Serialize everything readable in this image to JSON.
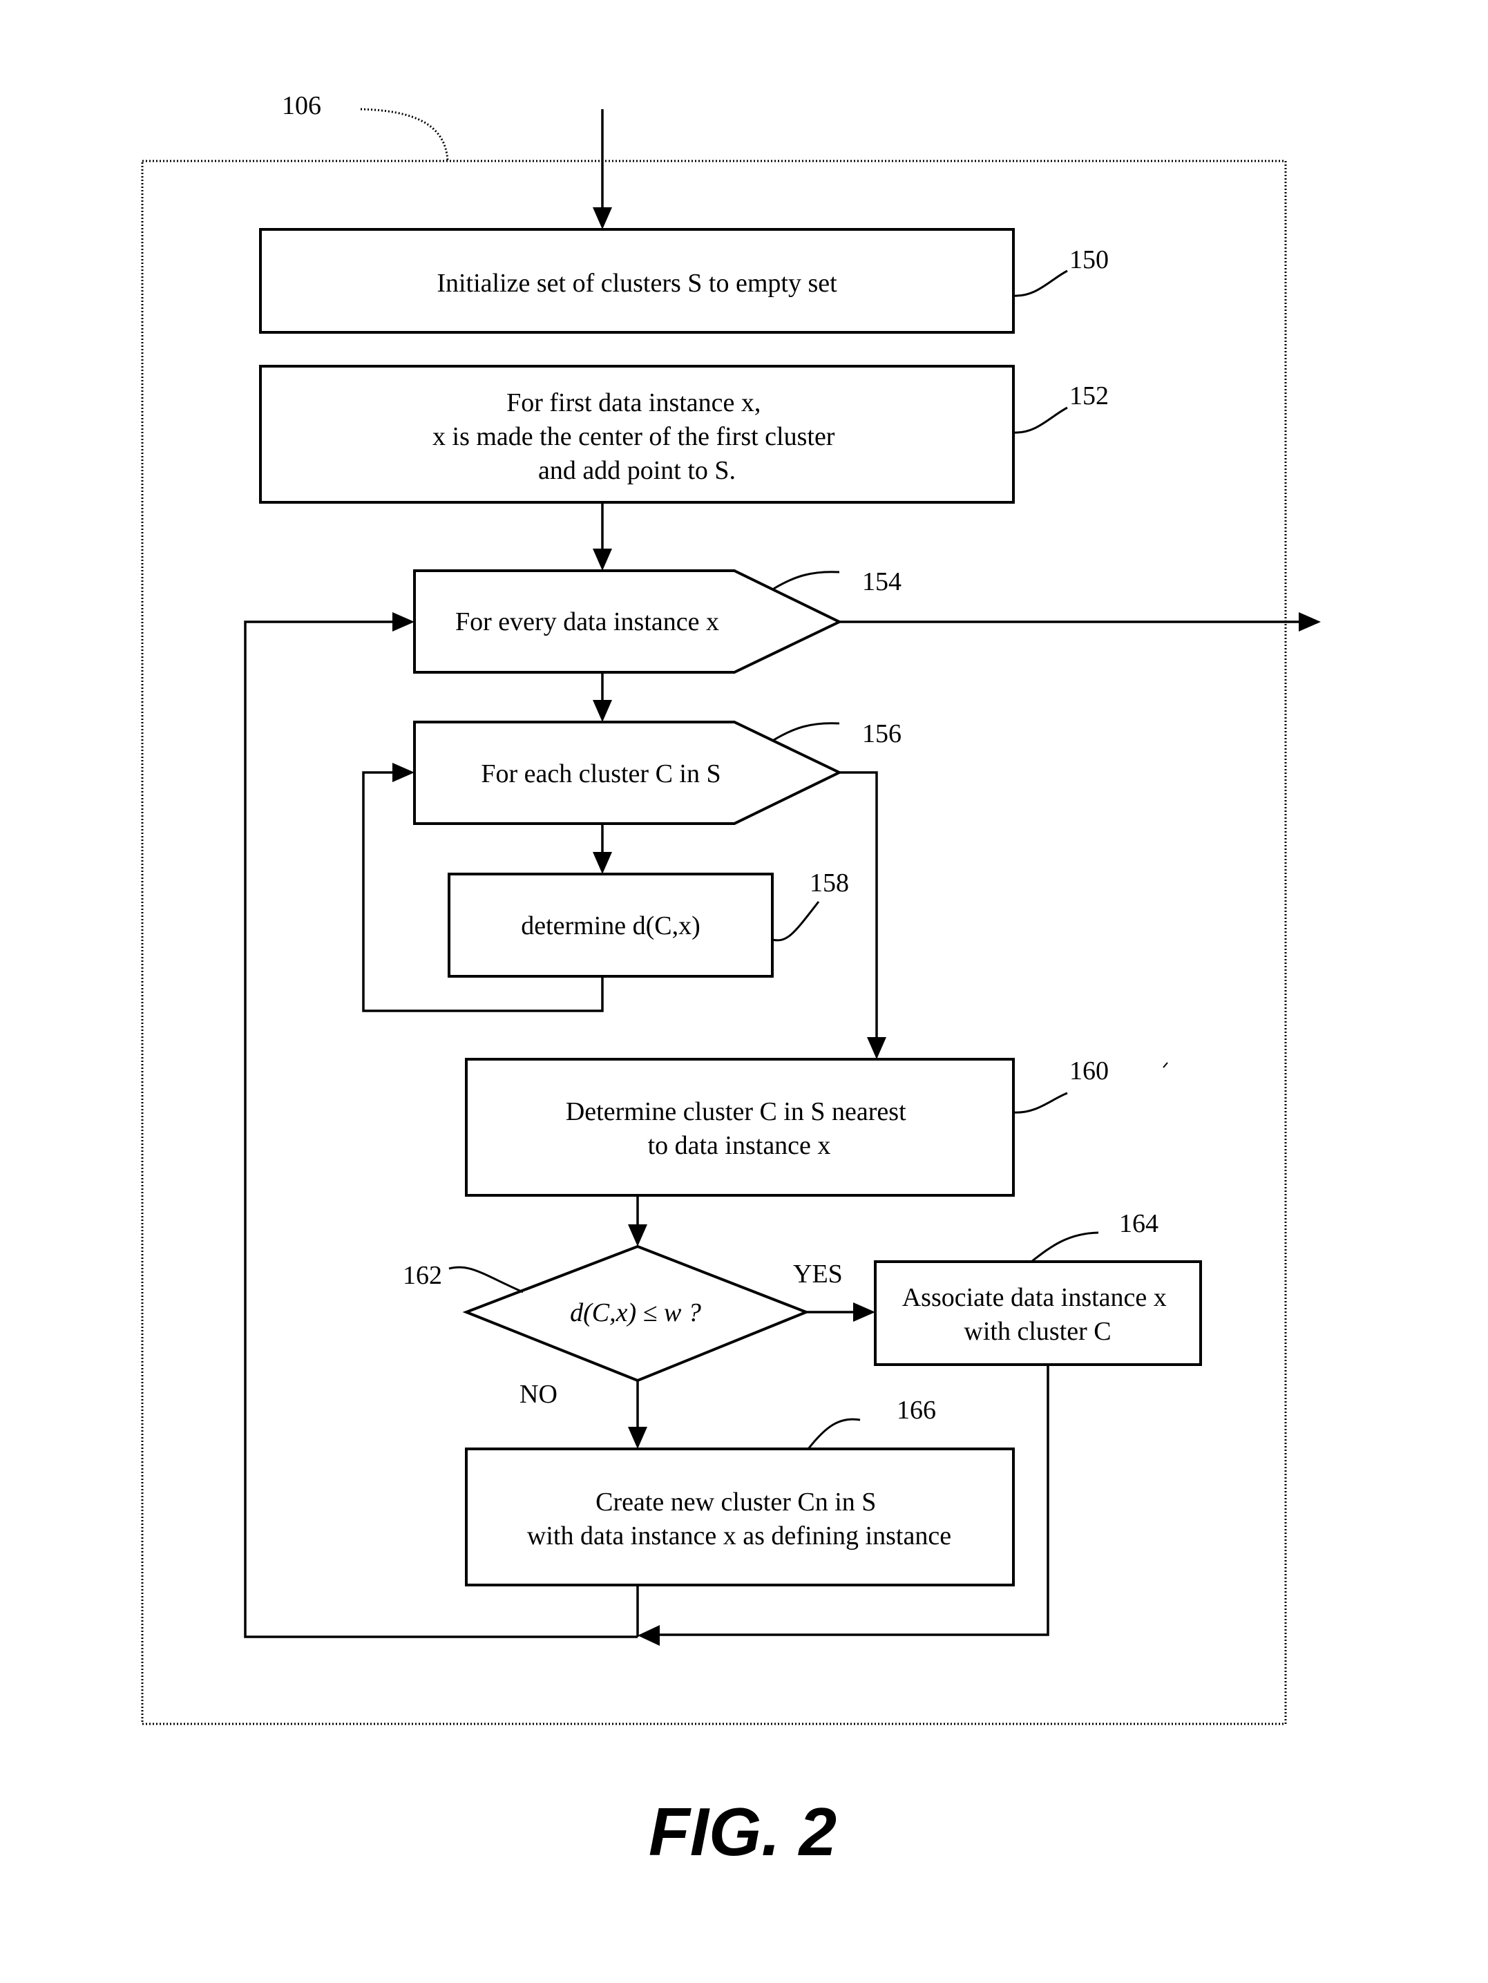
{
  "figure": {
    "title": "FIG. 2",
    "container_ref": "106"
  },
  "steps": {
    "s150": {
      "ref": "150",
      "lines": [
        "Initialize set of clusters S to empty set"
      ]
    },
    "s152": {
      "ref": "152",
      "lines": [
        "For first data instance x,",
        "x is made the center of the first cluster",
        "and add point to S."
      ]
    },
    "s154": {
      "ref": "154",
      "lines": [
        "For every data instance x"
      ]
    },
    "s156": {
      "ref": "156",
      "lines": [
        "For each cluster C in S"
      ]
    },
    "s158": {
      "ref": "158",
      "lines": [
        "determine d(C,x)"
      ]
    },
    "s160": {
      "ref": "160",
      "lines": [
        "Determine cluster C in S nearest",
        "to data instance x"
      ]
    },
    "s162": {
      "ref": "162",
      "lines": [
        "d(C,x) ≤ w ?"
      ]
    },
    "s164": {
      "ref": "164",
      "lines": [
        "Associate data instance x",
        "with cluster C"
      ]
    },
    "s166": {
      "ref": "166",
      "lines": [
        "Create new cluster Cn in S",
        "with data instance x as defining instance"
      ]
    }
  },
  "branches": {
    "yes": "YES",
    "no": "NO"
  }
}
